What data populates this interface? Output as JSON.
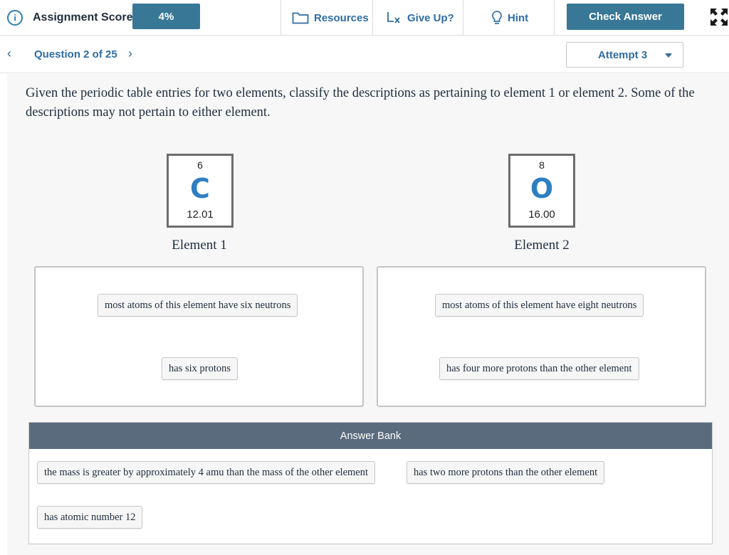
{
  "header": {
    "score_label": "Assignment Score:",
    "score_value": "4%",
    "resources_label": "Resources",
    "giveup_label": "Give Up?",
    "hint_label": "Hint",
    "check_label": "Check Answer"
  },
  "nav": {
    "question_label": "Question 2 of 25",
    "attempt_label": "Attempt 3"
  },
  "question": {
    "text": "Given the periodic table entries for two elements, classify the descriptions as pertaining to element 1 or element 2. Some of the descriptions may not pertain to either element."
  },
  "elements": [
    {
      "number": "6",
      "symbol": "C",
      "mass": "12.01",
      "label": "Element 1"
    },
    {
      "number": "8",
      "symbol": "O",
      "mass": "16.00",
      "label": "Element 2"
    }
  ],
  "zones": {
    "element1": [
      "most atoms of this element have six neutrons",
      "has six protons"
    ],
    "element2": [
      "most atoms of this element have eight neutrons",
      "has four more protons than the other element"
    ]
  },
  "bank": {
    "title": "Answer Bank",
    "items": [
      "the mass is greater by approximately 4 amu than the mass of the other element",
      "has two more protons than the other element",
      "has atomic number 12"
    ]
  },
  "colors": {
    "primary": "#387896",
    "link": "#2e6da4",
    "element_symbol": "#2e7fc0",
    "bank_header": "#5a6b7d"
  }
}
